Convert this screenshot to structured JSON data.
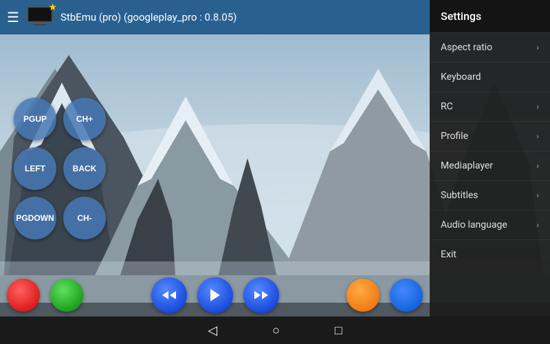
{
  "app": {
    "title": "StbEmu (pro) (googleplay_pro : 0.8.05)"
  },
  "topbar": {
    "hamburger": "☰",
    "star": "★"
  },
  "controls": {
    "buttons": [
      {
        "label": "PGUP",
        "row": 0
      },
      {
        "label": "CH+",
        "row": 0
      },
      {
        "label": "LEFT",
        "row": 1
      },
      {
        "label": "BACK",
        "row": 1
      },
      {
        "label": "PGDOWN",
        "row": 2
      },
      {
        "label": "CH-",
        "row": 2
      }
    ]
  },
  "menu": {
    "header": "Settings",
    "items": [
      {
        "label": "Aspect ratio",
        "has_arrow": true
      },
      {
        "label": "Keyboard",
        "has_arrow": false
      },
      {
        "label": "RC",
        "has_arrow": true
      },
      {
        "label": "Profile",
        "has_arrow": true
      },
      {
        "label": "Mediaplayer",
        "has_arrow": true
      },
      {
        "label": "Subtitles",
        "has_arrow": true
      },
      {
        "label": "Audio language",
        "has_arrow": true
      },
      {
        "label": "Exit",
        "has_arrow": false
      }
    ]
  },
  "navbar": {
    "back_icon": "◁",
    "home_icon": "○",
    "recent_icon": "□"
  },
  "playback": {
    "rewind": "⏮",
    "play": "▶",
    "forward": "⏭"
  }
}
